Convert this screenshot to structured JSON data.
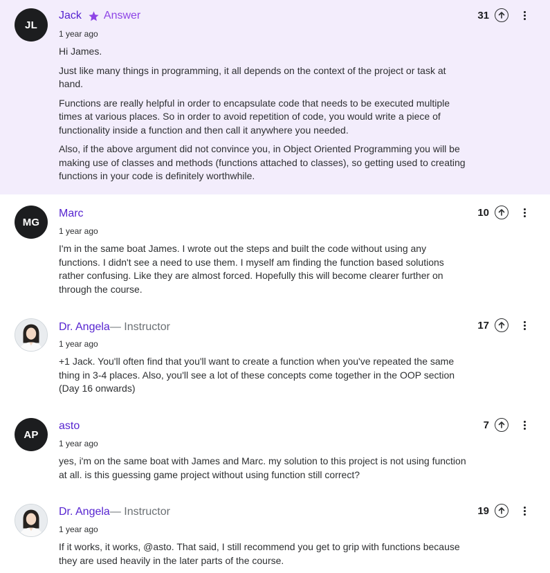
{
  "replies": [
    {
      "initials": "JL",
      "name": "Jack",
      "answer_label": "Answer",
      "time": "1 year ago",
      "votes": "31",
      "paragraphs": [
        "Hi James.",
        "Just like many things in programming, it all depends on the context of the project or task at hand.",
        "Functions are really helpful in order to encapsulate code that needs to be executed multiple times at various places. So in order to avoid repetition of code, you would write a piece of functionality inside a function and then call it anywhere you needed.",
        "Also, if the above argument did not convince you, in Object Oriented Programming you will be making use of classes and methods (functions attached to classes), so getting used to creating functions in your code is definitely worthwhile."
      ]
    },
    {
      "initials": "MG",
      "name": "Marc",
      "time": "1 year ago",
      "votes": "10",
      "paragraphs": [
        "I'm in the same boat James.  I wrote out the steps and built the code without using any functions.  I didn't see a need to use them.  I myself am finding the function based solutions rather confusing.  Like they are almost forced.  Hopefully this will become clearer further on through the course."
      ]
    },
    {
      "name": "Dr. Angela",
      "role": " — Instructor",
      "time": "1 year ago",
      "votes": "17",
      "paragraphs": [
        "+1 Jack. You'll often find that you'll want to create a function when you've repeated the same thing in 3-4 places. Also, you'll see a lot of these concepts come together in the OOP section (Day 16 onwards)"
      ]
    },
    {
      "initials": "AP",
      "name": "asto",
      "time": "1 year ago",
      "votes": "7",
      "paragraphs": [
        "yes, i'm on the same boat with James and Marc. my solution to this project is not using function at all. is this guessing game project without using function still correct?"
      ]
    },
    {
      "name": "Dr. Angela",
      "role": " — Instructor",
      "time": "1 year ago",
      "votes": "19",
      "paragraphs": [
        "If it works, it works, @asto. That said, I still recommend you get to grip with functions because they are used heavily in the later parts of the course."
      ]
    }
  ],
  "colors": {
    "answer_bg": "#f3edfc",
    "name": "#5624d0",
    "answer_badge": "#8e45e6"
  },
  "icons": [
    "star-icon",
    "arrow-up-icon",
    "more-vertical-icon"
  ]
}
